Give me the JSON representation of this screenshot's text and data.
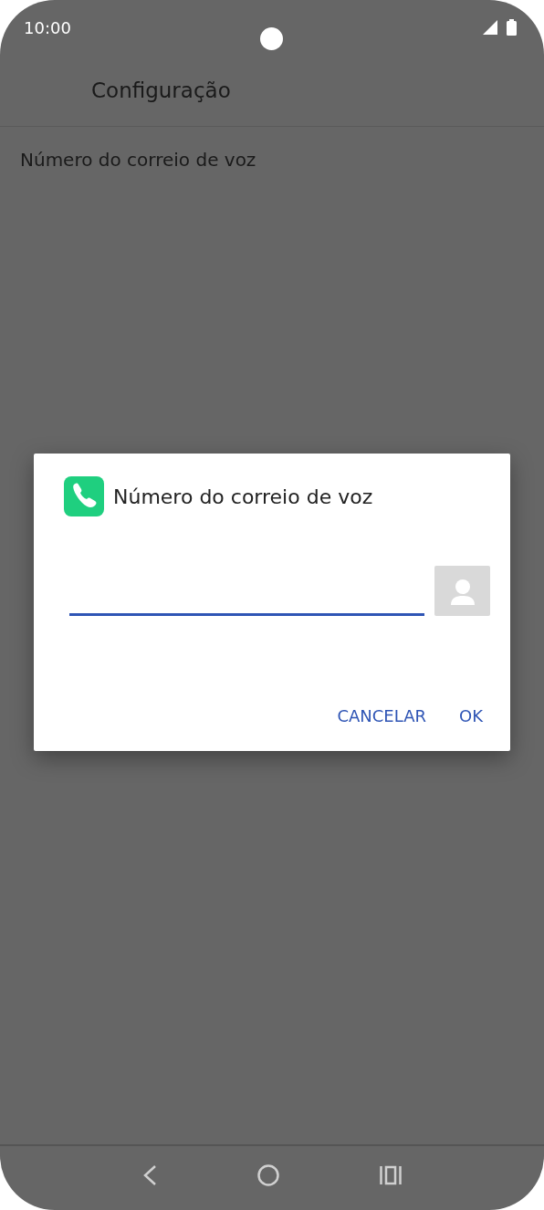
{
  "status_bar": {
    "time": "10:00"
  },
  "app_bar": {
    "title": "Configuração"
  },
  "settings": [
    {
      "label": "Número do correio de voz"
    }
  ],
  "dialog": {
    "title": "Número do correio de voz",
    "field": {
      "focused": true
    },
    "buttons": [
      {
        "label": "CANCELAR"
      },
      {
        "label": "OK"
      }
    ]
  }
}
